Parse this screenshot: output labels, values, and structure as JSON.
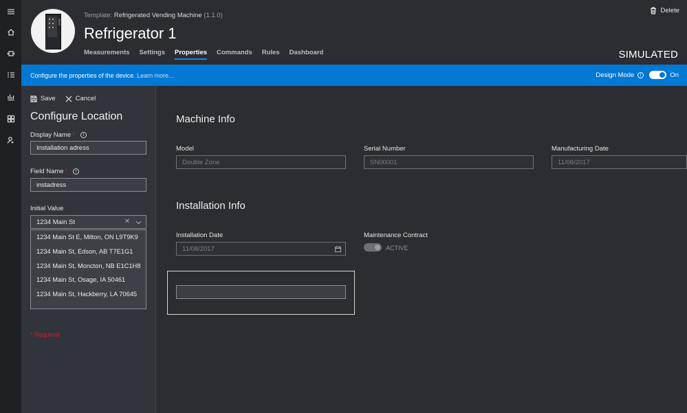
{
  "nav": {
    "icons": [
      "menu-icon",
      "home-icon",
      "devices-icon",
      "rules-icon",
      "analytics-icon",
      "dashboard-icon",
      "admin-icon"
    ]
  },
  "header": {
    "template_prefix": "Template:",
    "template_name": "Refrigerated Vending Machine",
    "template_version": "(1.1.0)",
    "title": "Refrigerator 1",
    "tabs": [
      {
        "label": "Measurements"
      },
      {
        "label": "Settings"
      },
      {
        "label": "Properties",
        "active": true
      },
      {
        "label": "Commands"
      },
      {
        "label": "Rules"
      },
      {
        "label": "Dashboard"
      }
    ],
    "delete_label": "Delete",
    "status": "SIMULATED"
  },
  "banner": {
    "message": "Configure the properties of the device.",
    "link": "Learn more...",
    "design_mode_label": "Design Mode",
    "toggle_label": "On",
    "color": "#0078d4"
  },
  "panel": {
    "save_label": "Save",
    "cancel_label": "Cancel",
    "title": "Configure Location",
    "display_name_label": "Display Name",
    "display_name_value": "Installation adress",
    "field_name_label": "Field Name",
    "field_name_value": "instadress",
    "initial_value_label": "Initial Value",
    "initial_value": "1234 Main St",
    "required_marker": "*",
    "suggestions": [
      "1234 Main St E, Milton, ON L9T9K9",
      "1234 Main St, Edson, AB T7E1G1",
      "1234 Main St, Moncton, NB E1C1H8",
      "1234 Main St, Osage, IA 50461",
      "1234 Main St, Hackberry, LA 70645"
    ],
    "required_note": "* Required"
  },
  "main": {
    "machine_info_title": "Machine Info",
    "model_label": "Model",
    "model_value": "Double Zone",
    "serial_label": "Serial Number",
    "serial_value": "SN00001",
    "mfg_label": "Manufacturing Date",
    "mfg_value": "11/08/2017",
    "installation_title": "Installation Info",
    "install_date_label": "Installation Date",
    "install_date_value": "11/08/2017",
    "maintenance_label": "Maintenance Contract",
    "maintenance_status": "ACTIVE"
  }
}
